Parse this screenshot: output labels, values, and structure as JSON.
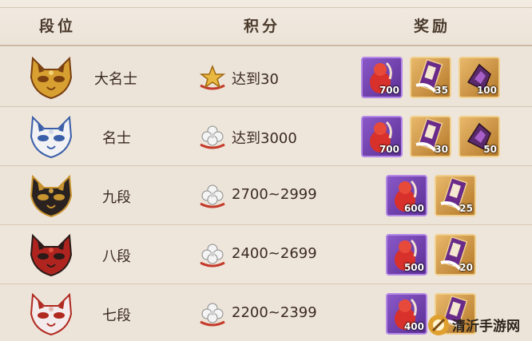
{
  "header": {
    "col_rank": "段位",
    "col_score": "积分",
    "col_reward": "奖励"
  },
  "rows": [
    {
      "rank": "大名士",
      "mask_icon": "golden-fox-mask-icon",
      "score_icon": "gold-star-icon",
      "score": "达到30",
      "rewards": [
        {
          "icon": "red-gourd-icon",
          "bg": "purple",
          "qty": "700"
        },
        {
          "icon": "skin-scroll-icon",
          "bg": "gold",
          "qty": "35"
        },
        {
          "icon": "purple-crystal-icon",
          "bg": "gold",
          "qty": "100"
        }
      ]
    },
    {
      "rank": "名士",
      "mask_icon": "white-blue-fox-mask-icon",
      "score_icon": "silver-flower-icon",
      "score": "达到3000",
      "rewards": [
        {
          "icon": "red-gourd-icon",
          "bg": "purple",
          "qty": "700"
        },
        {
          "icon": "skin-scroll-icon",
          "bg": "gold",
          "qty": "30"
        },
        {
          "icon": "purple-crystal-icon",
          "bg": "gold",
          "qty": "50"
        }
      ]
    },
    {
      "rank": "九段",
      "mask_icon": "black-gold-fox-mask-icon",
      "score_icon": "silver-flower-icon",
      "score": "2700~2999",
      "rewards": [
        {
          "icon": "red-gourd-icon",
          "bg": "purple",
          "qty": "600"
        },
        {
          "icon": "skin-scroll-icon",
          "bg": "gold",
          "qty": "25"
        }
      ]
    },
    {
      "rank": "八段",
      "mask_icon": "red-fox-mask-icon",
      "score_icon": "silver-flower-icon",
      "score": "2400~2699",
      "rewards": [
        {
          "icon": "red-gourd-icon",
          "bg": "purple",
          "qty": "500"
        },
        {
          "icon": "skin-scroll-icon",
          "bg": "gold",
          "qty": "20"
        }
      ]
    },
    {
      "rank": "七段",
      "mask_icon": "white-red-fox-mask-icon",
      "score_icon": "silver-flower-icon",
      "score": "2200~2399",
      "rewards": [
        {
          "icon": "red-gourd-icon",
          "bg": "purple",
          "qty": "400"
        },
        {
          "icon": "skin-scroll-icon",
          "bg": "gold",
          "qty": ""
        }
      ]
    }
  ],
  "watermark": {
    "text": "清沂手游网",
    "icon": "watermark-logo-icon"
  },
  "colors": {
    "background": "#eee5da",
    "text": "#3a2a20",
    "purple_frame": "#8a58c8",
    "gold_frame": "#e8b86a"
  }
}
